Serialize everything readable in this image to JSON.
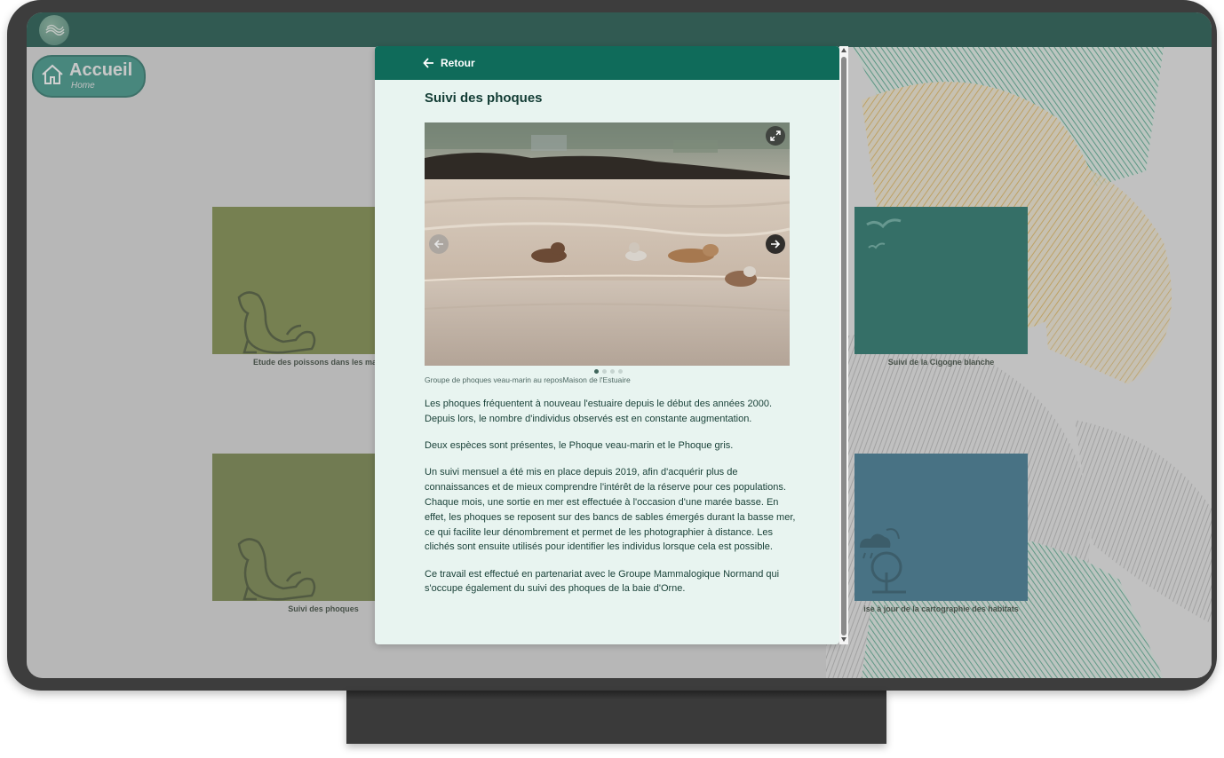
{
  "home": {
    "label": "Accueil",
    "sub": "Home"
  },
  "tiles": [
    {
      "caption": "Etude des poissons dans les marais en",
      "color": "#75843c"
    },
    {
      "caption": "Suivi de la Cigogne blanche",
      "color": "#116a5e"
    },
    {
      "caption": "Suivi des phoques",
      "color": "#6e7d3e"
    },
    {
      "caption": "ise à jour de la cartographie des habitats",
      "color": "#2f6f8a"
    }
  ],
  "modal": {
    "back_label": "Retour",
    "title": "Suivi des phoques",
    "caption": "Groupe de phoques veau-marin au reposMaison de l'Estuaire",
    "carousel": {
      "slides": 4,
      "active": 1
    },
    "paragraphs": [
      "Les phoques fréquentent à nouveau l'estuaire depuis le début des années 2000. Depuis lors, le nombre d'individus observés est en constante augmentation.",
      "Deux espèces sont présentes, le Phoque veau-marin et le Phoque gris.",
      "Un suivi mensuel a été mis en place depuis 2019, afin d'acquérir plus de connaissances et de mieux comprendre l'intérêt de la réserve pour ces populations. Chaque mois, une sortie en mer est effectuée à l'occasion d'une marée basse. En effet, les phoques se reposent sur des bancs de sables émergés durant la basse mer, ce qui facilite leur dénombrement et permet de les photographier à distance. Les clichés sont ensuite utilisés pour identifier les individus lorsque cela est possible.",
      "Ce travail est effectué en partenariat avec le Groupe Mammalogique Normand qui s'occupe également du suivi des phoques de la baie d'Orne."
    ]
  },
  "colors": {
    "header": "#0f6b5a",
    "topbar": "#0b4a3e",
    "modal_bg": "#e8f4f0",
    "text": "#173f36"
  }
}
